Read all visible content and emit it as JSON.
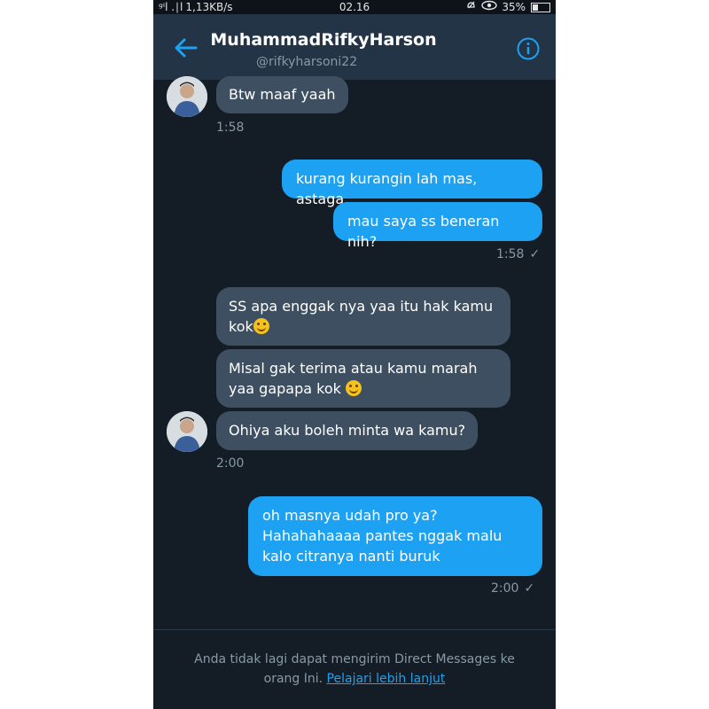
{
  "status_bar": {
    "signal": "ᵍᴵl .∣l",
    "speed": "1,13KB/s",
    "time": "02.16",
    "battery": "35%",
    "battery_level": 0.35
  },
  "header": {
    "name": "MuhammadRifkyHarson",
    "handle": "@rifkyharsoni22"
  },
  "messages": [
    {
      "from": "them",
      "text": "Btw maaf yaah"
    },
    {
      "from": "them",
      "time": "1:58"
    },
    {
      "from": "me",
      "text": "kurang kurangin lah mas, astaga."
    },
    {
      "from": "me",
      "text": "mau saya ss beneran nih?"
    },
    {
      "from": "me",
      "time": "1:58"
    },
    {
      "from": "them",
      "text1": "SS apa enggak nya yaa itu hak kamu",
      "text2": "kok"
    },
    {
      "from": "them",
      "text1": "Misal gak terima atau kamu marah",
      "text2": "yaa gapapa kok"
    },
    {
      "from": "them",
      "text": "Ohiya aku boleh minta wa kamu?"
    },
    {
      "from": "them",
      "time": "2:00"
    },
    {
      "from": "me",
      "text1": "oh masnya udah pro ya?",
      "text2": "Hahahahaaaa pantes nggak malu",
      "text3": "kalo citranya nanti buruk"
    },
    {
      "from": "me",
      "time": "2:00"
    }
  ],
  "footer": {
    "text1": "Anda tidak lagi dapat mengirim Direct Messages ke",
    "text2": "orang Ini.",
    "link": "Pelajari lebih lanjut"
  },
  "colors": {
    "background": "#141d26",
    "header": "#243447",
    "incoming_bubble": "#3d4f61",
    "outgoing_bubble": "#1da1f2",
    "muted": "#8899a6"
  },
  "icons": {
    "back": "arrow-left-icon",
    "info": "info-icon",
    "check": "check-icon",
    "emoji": "smiling-face-emoji"
  }
}
